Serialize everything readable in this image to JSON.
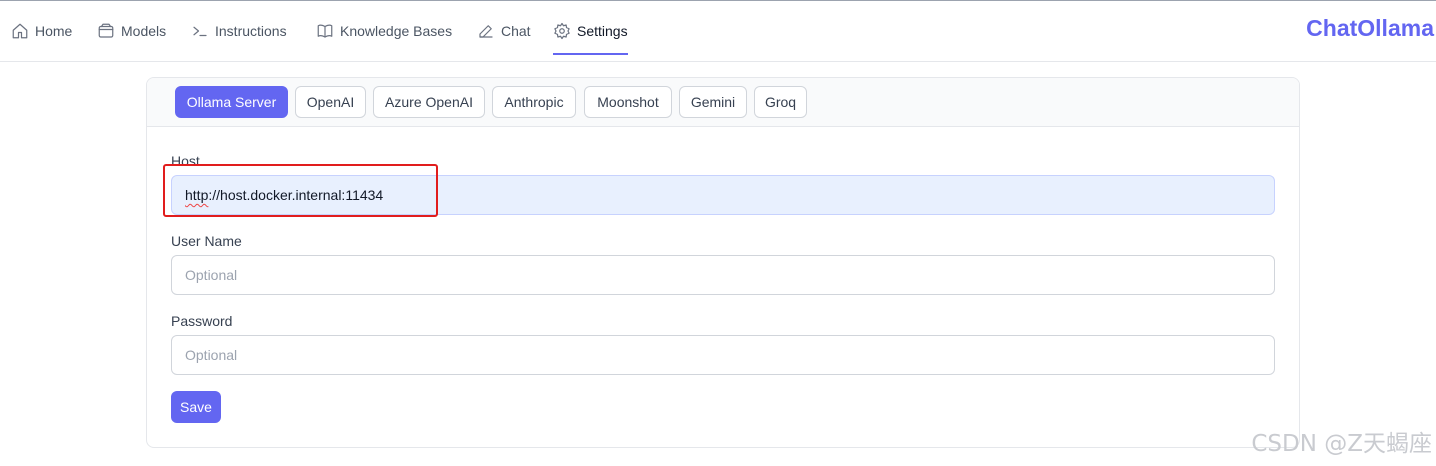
{
  "nav": {
    "items": [
      {
        "label": "Home",
        "icon": "home-icon"
      },
      {
        "label": "Models",
        "icon": "box-icon"
      },
      {
        "label": "Instructions",
        "icon": "terminal-icon"
      },
      {
        "label": "Knowledge Bases",
        "icon": "book-icon"
      },
      {
        "label": "Chat",
        "icon": "edit-icon"
      },
      {
        "label": "Settings",
        "icon": "gear-icon",
        "active": true
      }
    ],
    "brand": "ChatOllama"
  },
  "tabs": [
    {
      "label": "Ollama Server",
      "active": true
    },
    {
      "label": "OpenAI"
    },
    {
      "label": "Azure OpenAI"
    },
    {
      "label": "Anthropic"
    },
    {
      "label": "Moonshot"
    },
    {
      "label": "Gemini"
    },
    {
      "label": "Groq"
    }
  ],
  "form": {
    "host": {
      "label": "Host",
      "value_prefix": "http",
      "value_rest": "://host.docker.internal:11434"
    },
    "username": {
      "label": "User Name",
      "placeholder": "Optional"
    },
    "password": {
      "label": "Password",
      "placeholder": "Optional"
    },
    "save_label": "Save"
  },
  "watermark": "CSDN @Z天蝎座",
  "colors": {
    "accent": "#6366f1",
    "highlight": "#e11d1d"
  }
}
